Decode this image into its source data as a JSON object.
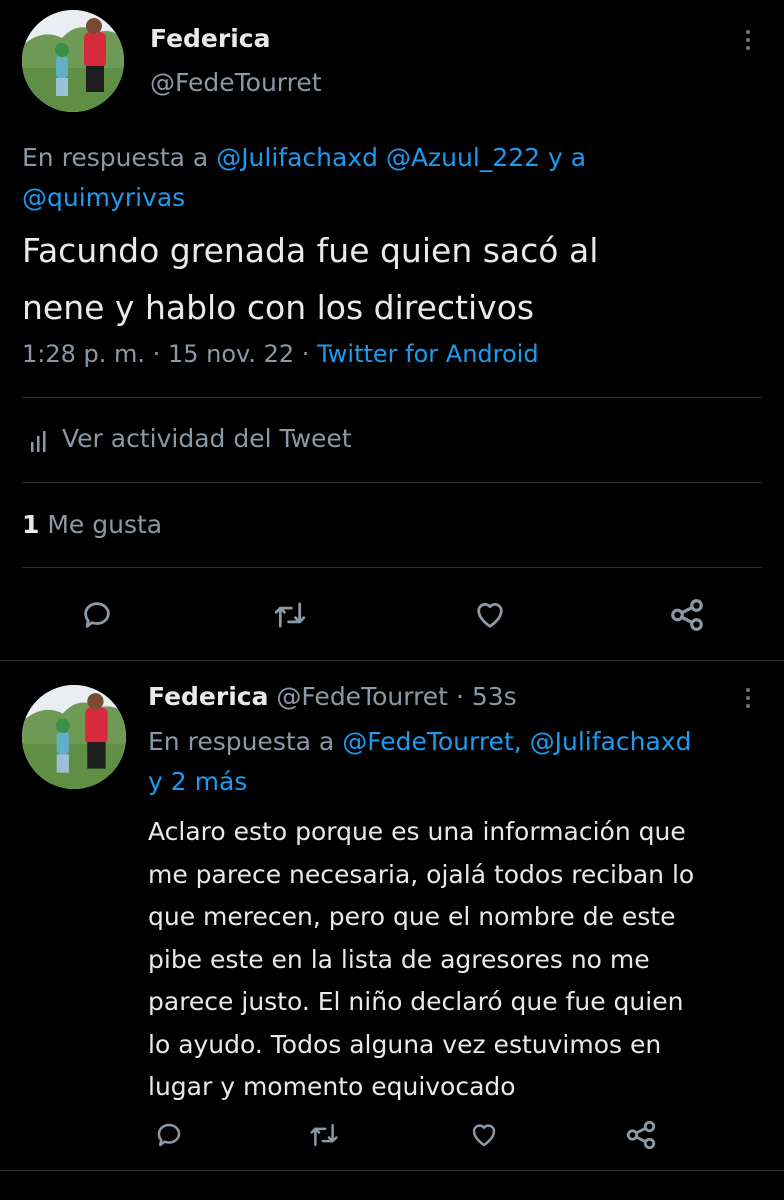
{
  "tweet": {
    "author_name": "Federica",
    "author_handle": "@FedeTourret",
    "reply_prefix": "En respuesta a",
    "reply_mention_1": "@Julifachaxd",
    "reply_mention_2": "@Azuul_222",
    "reply_and": "y a",
    "reply_mention_3": "@quimyrivas",
    "text_line_1": "Facundo grenada fue quien sacó al",
    "text_line_2": "nene y hablo con los directivos",
    "time": "1:28 p. m.",
    "date": "15 nov. 22",
    "separator": "·",
    "source": "Twitter for Android",
    "activity_label": "Ver actividad del Tweet",
    "likes_count": "1",
    "likes_label": "Me gusta"
  },
  "reply": {
    "author_name": "Federica",
    "author_handle": "@FedeTourret",
    "time_ago": "53s",
    "separator": "·",
    "reply_prefix": "En respuesta a",
    "reply_mentions": "@FedeTourret, @Julifachaxd",
    "reply_more": "y 2 más",
    "text_lines": [
      "Aclaro esto porque es una información que",
      "me parece necesaria, ojalá todos reciban lo",
      "que merecen, pero que el nombre de este",
      "pibe este en la lista de agresores no me",
      "parece justo. El niño declaró que fue quien",
      "lo ayudo. Todos alguna vez estuvimos en",
      "lugar y momento equivocado"
    ]
  },
  "icons": {
    "reply": "reply-icon",
    "retweet": "retweet-icon",
    "like": "heart-icon",
    "share": "share-icon",
    "activity": "bar-chart-icon",
    "more": "more-icon"
  },
  "colors": {
    "background": "#000000",
    "text": "#e7e9ea",
    "muted": "#8b98a5",
    "link": "#1d9bf0",
    "divider": "#2f3336"
  }
}
